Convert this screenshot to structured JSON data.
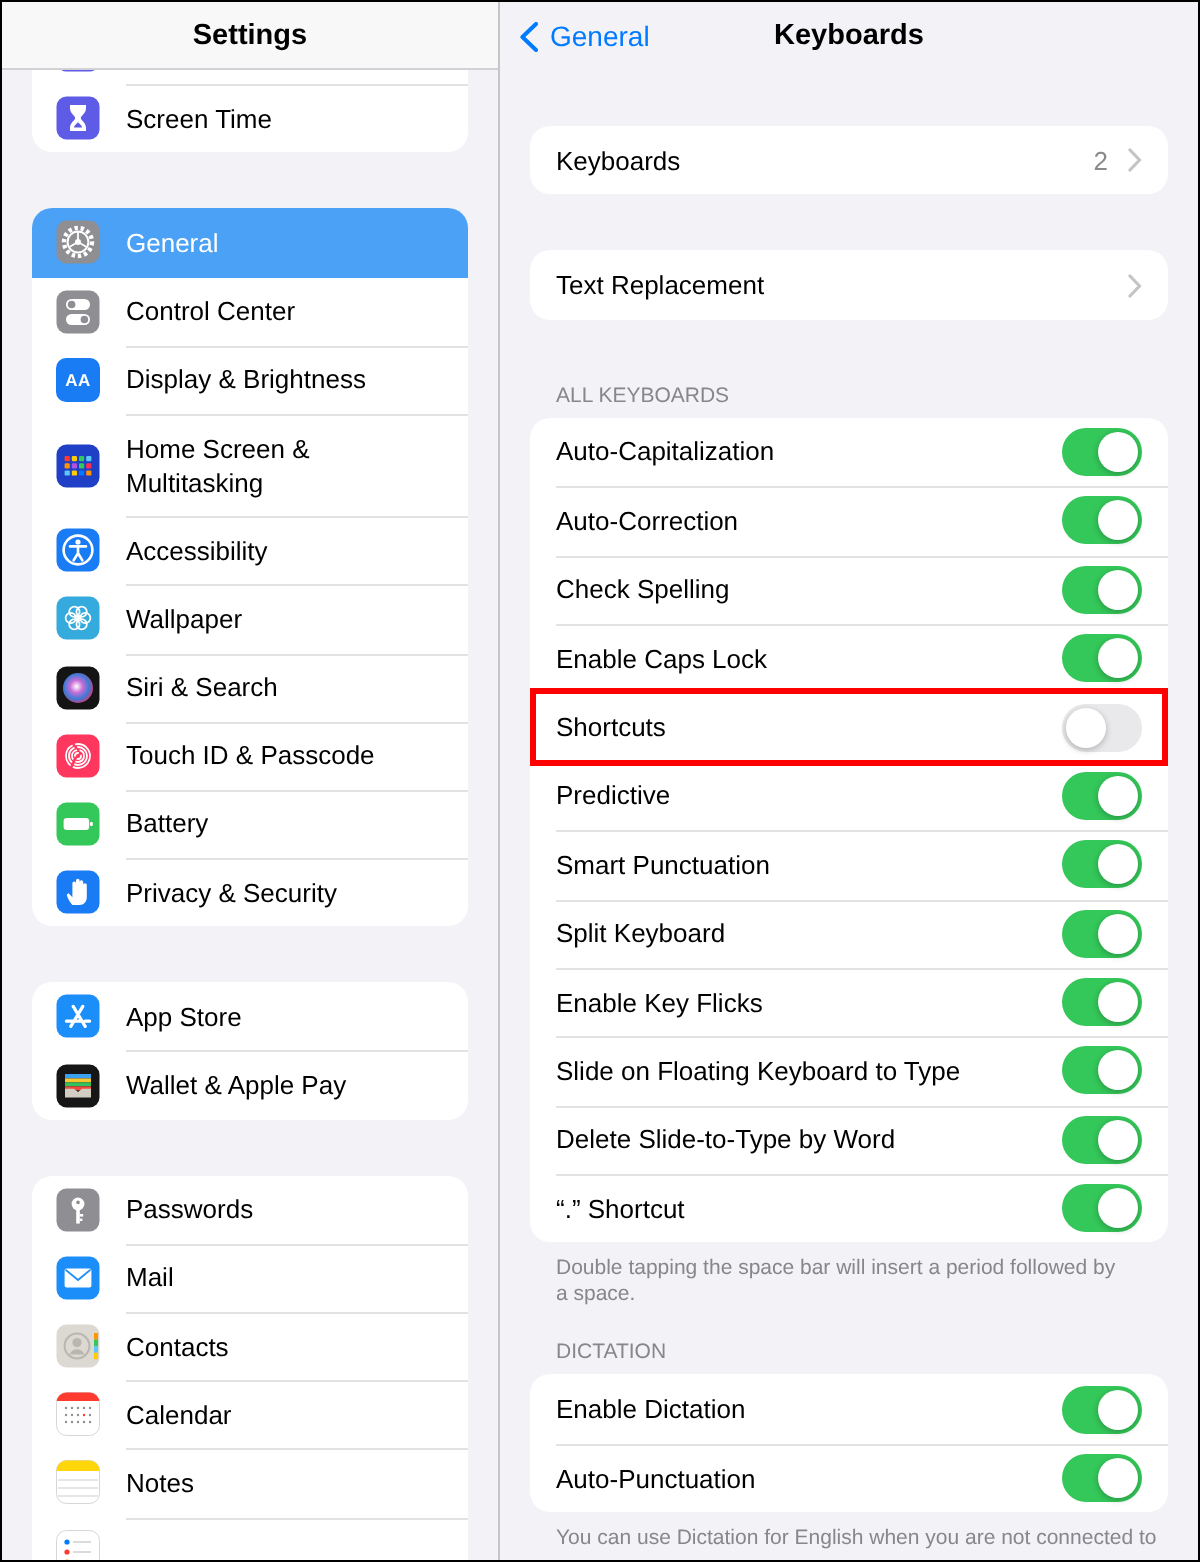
{
  "sidebar": {
    "title": "Settings",
    "groups": [
      {
        "items": [
          {
            "selected": false
          },
          {
            "label": "Screen Time",
            "selected": false
          }
        ]
      },
      {
        "items": [
          {
            "label": "General",
            "selected": true
          },
          {
            "label": "Control Center",
            "selected": false
          },
          {
            "label": "Display & Brightness",
            "icon_text": "AA",
            "selected": false
          },
          {
            "label": "Home Screen & Multitasking",
            "selected": false
          },
          {
            "label": "Accessibility",
            "selected": false
          },
          {
            "label": "Wallpaper",
            "selected": false
          },
          {
            "label": "Siri & Search",
            "selected": false
          },
          {
            "label": "Touch ID & Passcode",
            "selected": false
          },
          {
            "label": "Battery",
            "selected": false
          },
          {
            "label": "Privacy & Security",
            "selected": false
          }
        ]
      },
      {
        "items": [
          {
            "label": "App Store",
            "selected": false
          },
          {
            "label": "Wallet & Apple Pay",
            "selected": false
          }
        ]
      },
      {
        "items": [
          {
            "label": "Passwords",
            "selected": false
          },
          {
            "label": "Mail",
            "selected": false
          },
          {
            "label": "Contacts",
            "selected": false
          },
          {
            "label": "Calendar",
            "selected": false
          },
          {
            "label": "Notes",
            "selected": false
          },
          {
            "selected": false
          }
        ]
      }
    ]
  },
  "detail": {
    "back": "General",
    "title": "Keyboards",
    "sections": [
      {
        "rows": [
          {
            "kind": "link",
            "label": "Keyboards",
            "value": "2"
          }
        ]
      },
      {
        "rows": [
          {
            "kind": "link",
            "label": "Text Replacement"
          }
        ]
      },
      {
        "header": "ALL KEYBOARDS",
        "rows": [
          {
            "kind": "toggle",
            "label": "Auto-Capitalization",
            "on": true,
            "highlighted": false
          },
          {
            "kind": "toggle",
            "label": "Auto-Correction",
            "on": true,
            "highlighted": false
          },
          {
            "kind": "toggle",
            "label": "Check Spelling",
            "on": true,
            "highlighted": false
          },
          {
            "kind": "toggle",
            "label": "Enable Caps Lock",
            "on": true,
            "highlighted": false
          },
          {
            "kind": "toggle",
            "label": "Shortcuts",
            "on": false,
            "highlighted": true
          },
          {
            "kind": "toggle",
            "label": "Predictive",
            "on": true,
            "highlighted": false
          },
          {
            "kind": "toggle",
            "label": "Smart Punctuation",
            "on": true,
            "highlighted": false
          },
          {
            "kind": "toggle",
            "label": "Split Keyboard",
            "on": true,
            "highlighted": false
          },
          {
            "kind": "toggle",
            "label": "Enable Key Flicks",
            "on": true,
            "highlighted": false
          },
          {
            "kind": "toggle",
            "label": "Slide on Floating Keyboard to Type",
            "on": true,
            "highlighted": false
          },
          {
            "kind": "toggle",
            "label": "Delete Slide-to-Type by Word",
            "on": true,
            "highlighted": false
          },
          {
            "kind": "toggle",
            "label": "“.” Shortcut",
            "on": true,
            "highlighted": false
          }
        ],
        "footer": "Double tapping the space bar will insert a period followed by a space."
      },
      {
        "header": "DICTATION",
        "rows": [
          {
            "kind": "toggle",
            "label": "Enable Dictation",
            "on": true,
            "highlighted": false
          },
          {
            "kind": "toggle",
            "label": "Auto-Punctuation",
            "on": true,
            "highlighted": false
          }
        ],
        "footer": "You can use Dictation for English when you are not connected to"
      }
    ]
  }
}
